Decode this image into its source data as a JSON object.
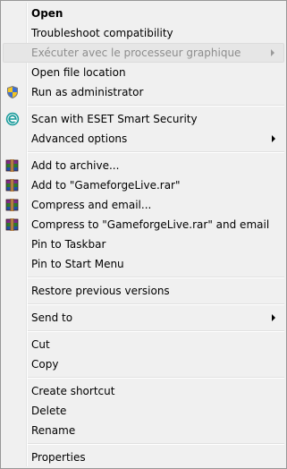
{
  "menu": {
    "items": [
      {
        "label": "Open"
      },
      {
        "label": "Troubleshoot compatibility"
      },
      {
        "label": "Exécuter avec le processeur graphique"
      },
      {
        "label": "Open file location"
      },
      {
        "label": "Run as administrator"
      },
      {
        "label": "Scan with ESET Smart Security"
      },
      {
        "label": "Advanced options"
      },
      {
        "label": "Add to archive..."
      },
      {
        "label": "Add to \"GameforgeLive.rar\""
      },
      {
        "label": "Compress and email..."
      },
      {
        "label": "Compress to \"GameforgeLive.rar\" and email"
      },
      {
        "label": "Pin to Taskbar"
      },
      {
        "label": "Pin to Start Menu"
      },
      {
        "label": "Restore previous versions"
      },
      {
        "label": "Send to"
      },
      {
        "label": "Cut"
      },
      {
        "label": "Copy"
      },
      {
        "label": "Create shortcut"
      },
      {
        "label": "Delete"
      },
      {
        "label": "Rename"
      },
      {
        "label": "Properties"
      }
    ]
  },
  "icons": {
    "uac_shield": "uac-shield-icon",
    "eset": "eset-icon",
    "winrar": "winrar-icon"
  },
  "colors": {
    "menu_background": "#f0f0f0",
    "menu_border": "#979797",
    "disabled_text": "#8d8d8d",
    "separator": "#e0e0e0",
    "eset_teal": "#1a9b9b"
  }
}
